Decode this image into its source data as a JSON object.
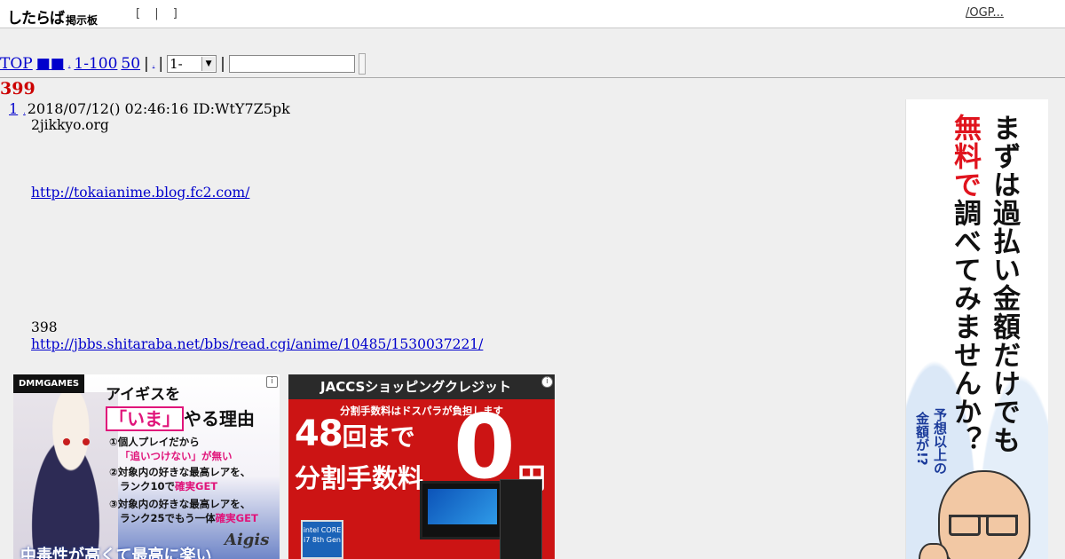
{
  "header": {
    "logo_main": "したらば",
    "logo_sub": "掲示板",
    "links": "[ | ]",
    "ogp_link": "/OGP..."
  },
  "nav": {
    "top": "TOP",
    "squares": "■■",
    "dot1": ".",
    "range_link": "1-100",
    "last_link": "50",
    "sep1": "|",
    "dot2": ".",
    "sep2": "|",
    "select_value": "1-",
    "sep3": "|",
    "search_placeholder": ""
  },
  "thread": {
    "title": "399"
  },
  "post": {
    "number": "1",
    "dot": ".",
    "meta": "2018/07/12() 02:46:16 ID:WtY7Z5pk",
    "line1": "2jikkyo.org",
    "link1": "http://tokaianime.blog.fc2.com/",
    "line2": "398",
    "link2": "http://jbbs.shitaraba.net/bbs/read.cgi/anime/10485/1530037221/"
  },
  "ads": {
    "info_icon": "i",
    "game": {
      "label": "DMMGAMES",
      "head1": "アイギスを",
      "head2_emph": "「いま」",
      "head2_rest": "やる理由",
      "p1": "①個人プレイだから",
      "p1b": "「追いつけない」が無い",
      "p2": "②対象内の好きな最高レアを、",
      "p2b_pre": "ランク10で",
      "p2b_emph": "確実GET",
      "p3": "③対象内の好きな最高レアを、",
      "p3b_pre": "ランク25でもう一体",
      "p3b_emph": "確実GET",
      "brand": "Aigis",
      "footer": "中毒性が高くて最高に楽い"
    },
    "jaccs": {
      "bar": "JACCSショッピングクレジット",
      "sub": "分割手数料はドスパラが負担します",
      "big1": "48",
      "big1_suffix": "回まで",
      "big2": "分割手数料",
      "zero": "0",
      "yen": "円",
      "badge": "intel CORE i7 8th Gen"
    },
    "side": {
      "col1": "まずは過払い金額だけでも",
      "col2_red": "無料で",
      "col2_rest": "調べてみませんか？",
      "col3": "予想以上の",
      "col4": "金額が!?"
    }
  }
}
